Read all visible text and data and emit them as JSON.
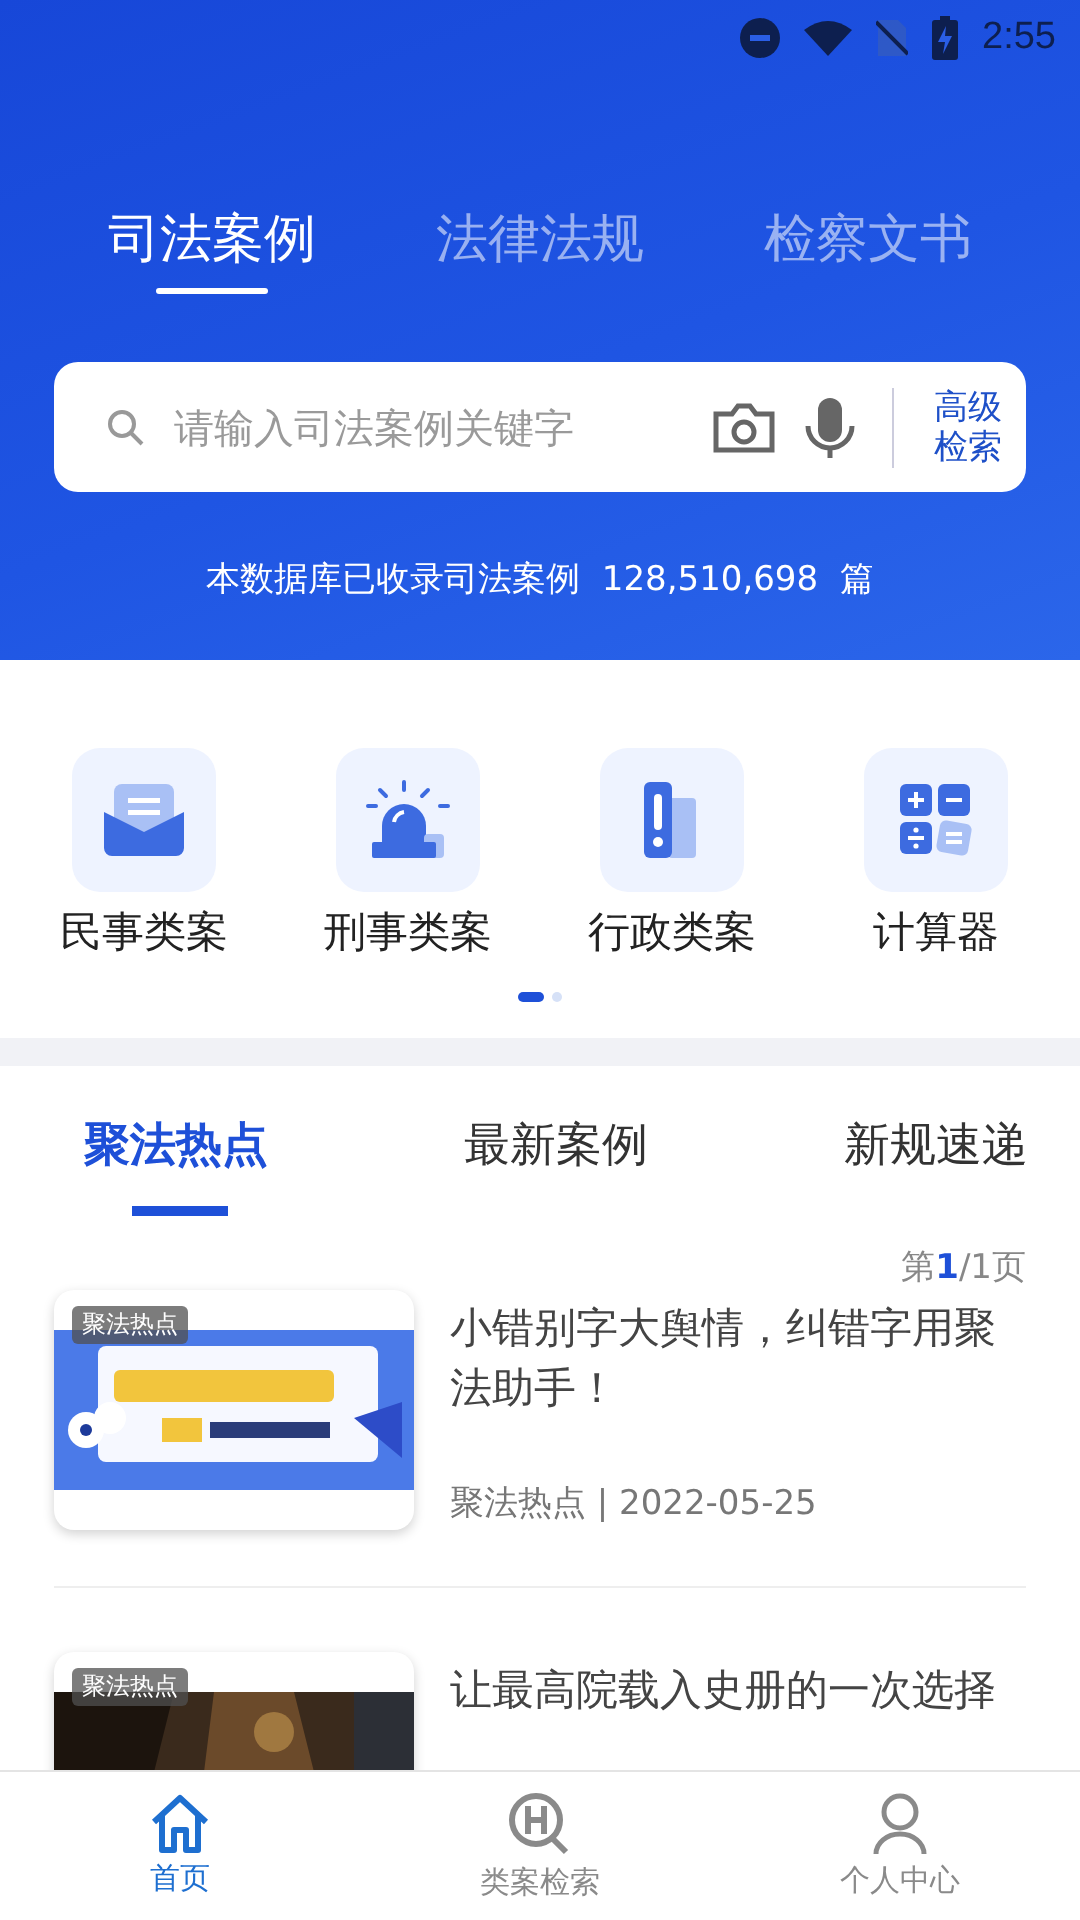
{
  "status_bar": {
    "time": "2:55"
  },
  "top_tabs": [
    {
      "label": "司法案例",
      "selected": true
    },
    {
      "label": "法律法规",
      "selected": false
    },
    {
      "label": "检察文书",
      "selected": false
    }
  ],
  "search": {
    "placeholder": "请输入司法案例关键字",
    "advanced_button": "高级检索"
  },
  "record_count": "本数据库已收录司法案例  128,510,698  篇",
  "categories": [
    {
      "label": "民事类案",
      "kind": "tray"
    },
    {
      "label": "刑事类案",
      "kind": "siren"
    },
    {
      "label": "行政类案",
      "kind": "binder"
    },
    {
      "label": "计算器",
      "kind": "calculator"
    }
  ],
  "pager_dots": [
    {
      "selected": true
    },
    {
      "selected": false
    }
  ],
  "news_tabs": [
    {
      "label": "聚法热点",
      "selected": true
    },
    {
      "label": "最新案例",
      "selected": false
    },
    {
      "label": "新规速递",
      "selected": false
    }
  ],
  "page_indicator": "第**1**/1页",
  "articles": [
    {
      "badge": "聚法热点",
      "title": "小错别字大舆情，纠错字用聚法助手！",
      "meta": "聚法热点 | 2022-05-25",
      "kind": "banner"
    },
    {
      "badge": "聚法热点",
      "title": "让最高院载入史册的一次选择",
      "kind": "dark"
    }
  ],
  "bottom_nav": [
    {
      "label": "首页",
      "kind": "home",
      "selected": true
    },
    {
      "label": "类案检索",
      "kind": "hq",
      "selected": false
    },
    {
      "label": "个人中心",
      "kind": "person",
      "selected": false
    }
  ]
}
